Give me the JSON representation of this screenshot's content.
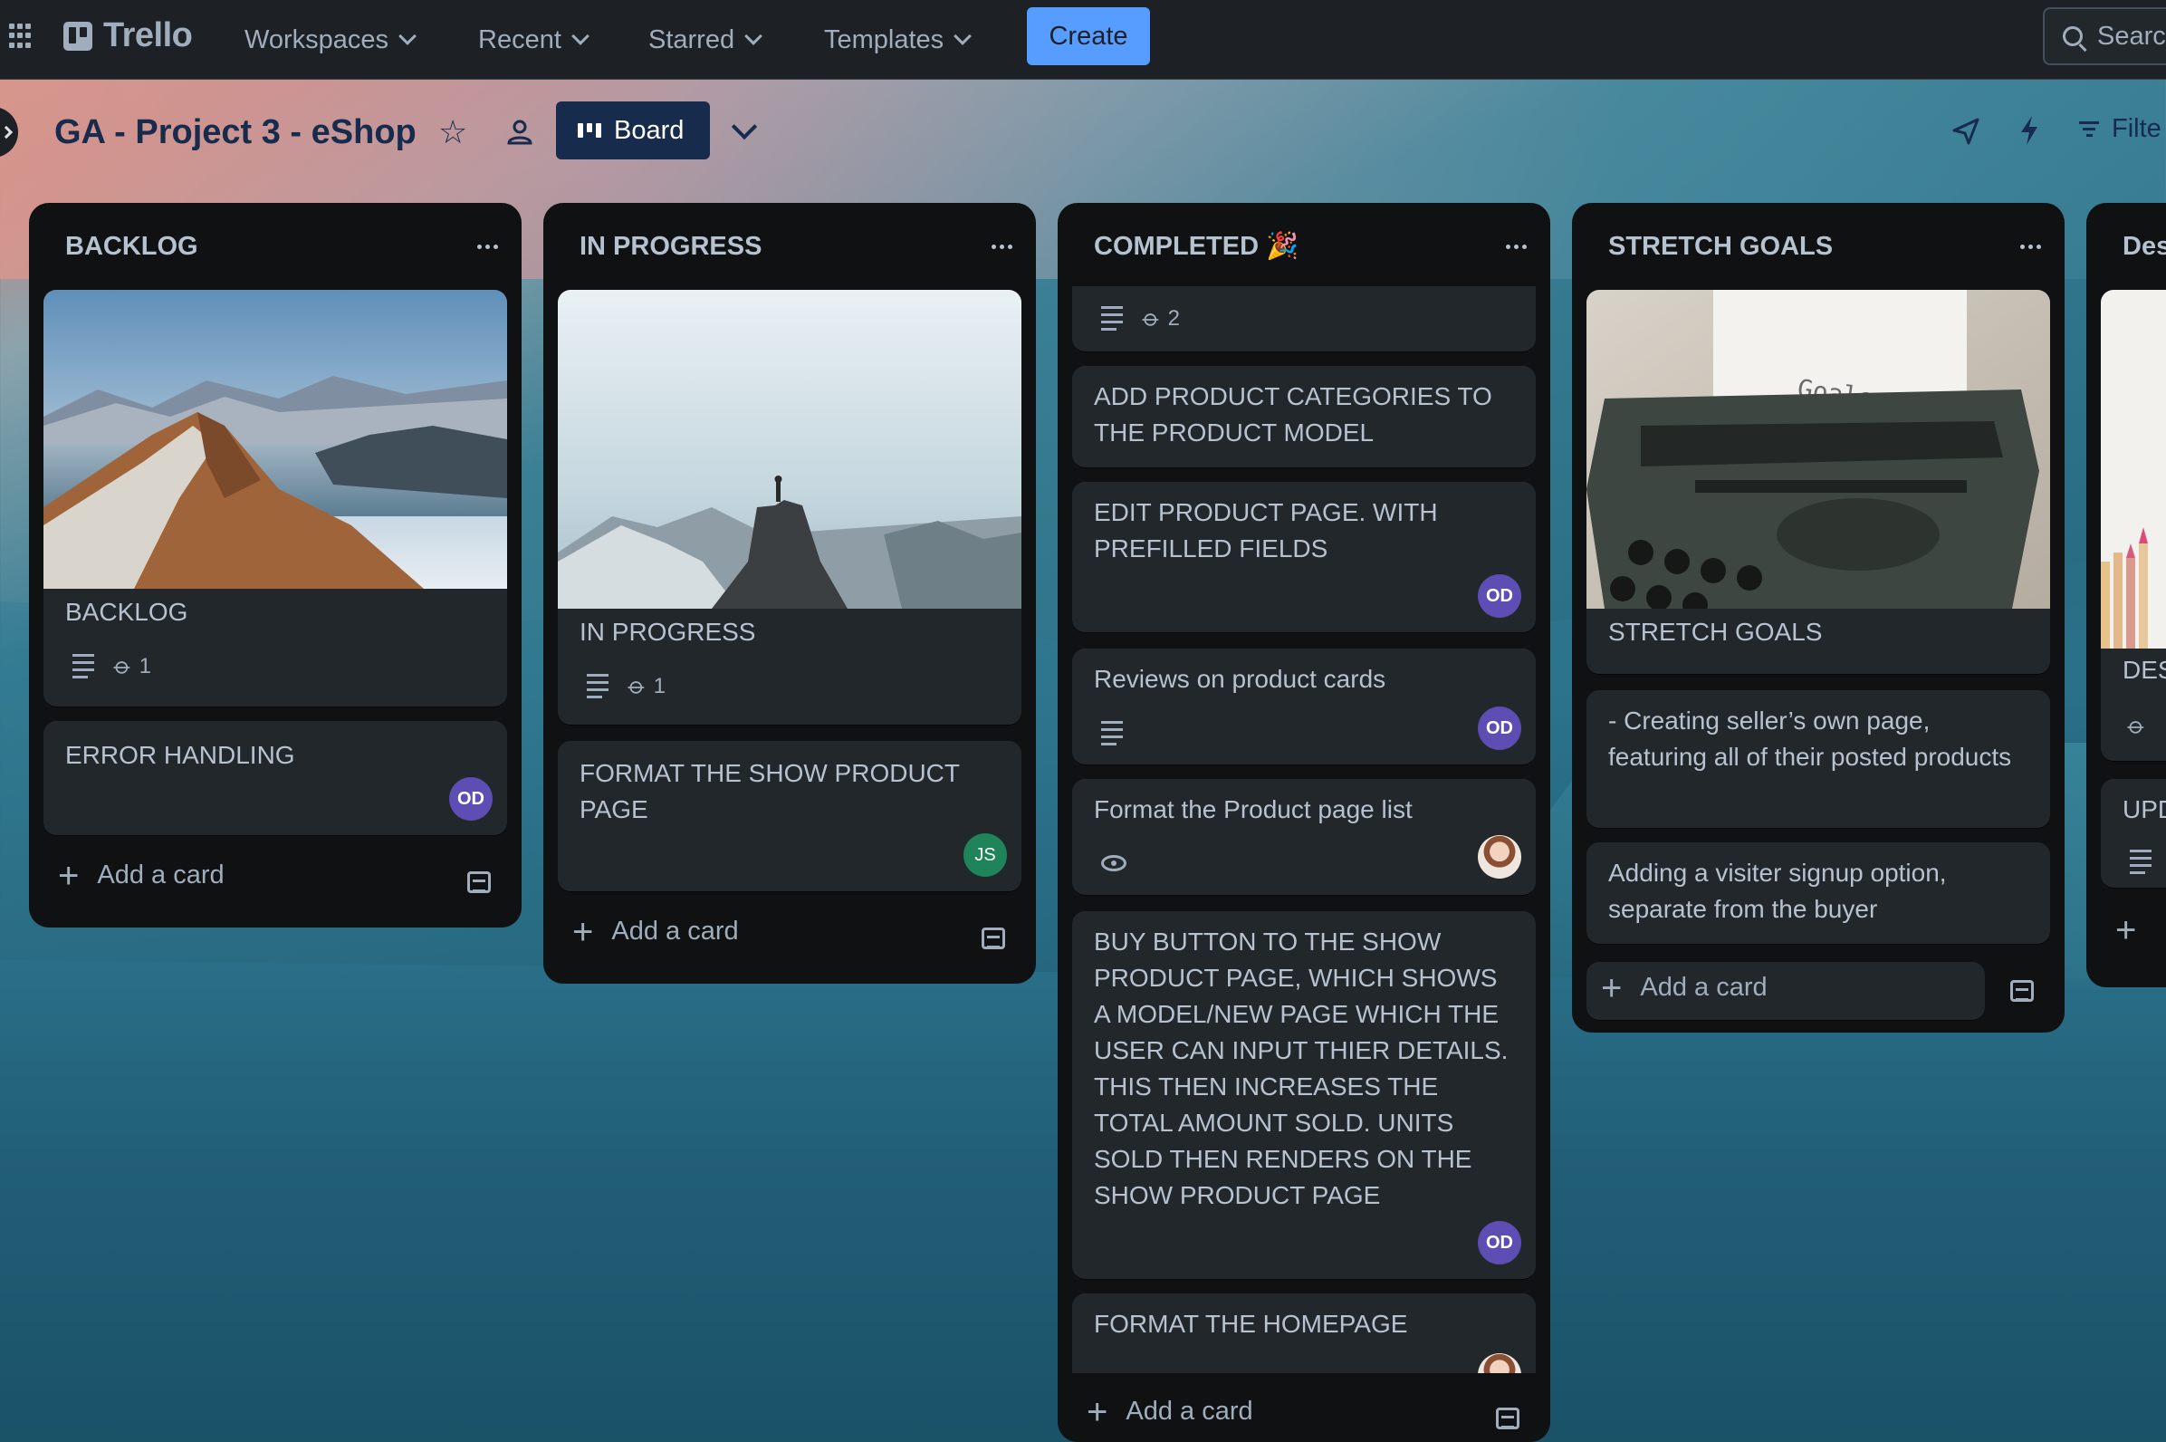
{
  "nav": {
    "brand": "Trello",
    "workspaces": "Workspaces",
    "recent": "Recent",
    "starred": "Starred",
    "templates": "Templates",
    "create": "Create",
    "search": "Searc"
  },
  "board": {
    "title": "GA - Project 3 - eShop",
    "view": "Board",
    "filter": "Filte"
  },
  "lists": [
    {
      "title": "BACKLOG",
      "cards": [
        {
          "title": "BACKLOG",
          "attachments": "1"
        },
        {
          "title": "ERROR HANDLING",
          "member": "OD"
        }
      ],
      "add_card": "Add a card"
    },
    {
      "title": "IN PROGRESS",
      "cards": [
        {
          "title": "IN PROGRESS",
          "attachments": "1"
        },
        {
          "title": "FORMAT THE SHOW PRODUCT PAGE",
          "member": "JS"
        }
      ],
      "add_card": "Add a card"
    },
    {
      "title": "COMPLETED 🎉",
      "cards": [
        {
          "attachments": "2"
        },
        {
          "title": "ADD PRODUCT CATEGORIES TO THE PRODUCT MODEL"
        },
        {
          "title": "EDIT PRODUCT PAGE. WITH PREFILLED FIELDS",
          "member": "OD"
        },
        {
          "title": "Reviews on product cards",
          "member": "OD"
        },
        {
          "title": "Format the Product page list"
        },
        {
          "title": "BUY BUTTON TO THE SHOW PRODUCT PAGE, WHICH SHOWS A MODEL/NEW PAGE WHICH THE USER CAN INPUT THIER DETAILS. THIS THEN INCREASES THE TOTAL AMOUNT SOLD. UNITS SOLD THEN RENDERS ON THE SHOW PRODUCT PAGE",
          "member": "OD"
        },
        {
          "title": "FORMAT THE HOMEPAGE"
        }
      ],
      "add_card": "Add a card"
    },
    {
      "title": "STRETCH GOALS",
      "cards": [
        {
          "title": "STRETCH GOALS",
          "image_text": "Goals"
        },
        {
          "title": "- Creating seller’s own page, featuring all of their posted products"
        },
        {
          "title": "Adding a visiter signup option, separate from the buyer"
        }
      ],
      "add_card": "Add a card"
    },
    {
      "title": "Des",
      "cards": [
        {
          "title": "DES"
        },
        {
          "title": "UPD"
        }
      ]
    }
  ],
  "colors": {
    "nav_bg": "#1d2125",
    "list_bg": "#0f1112",
    "card_bg": "#22272b",
    "accent": "#579dff",
    "avatar_od": "#5e4db2",
    "avatar_js": "#1f845a"
  }
}
